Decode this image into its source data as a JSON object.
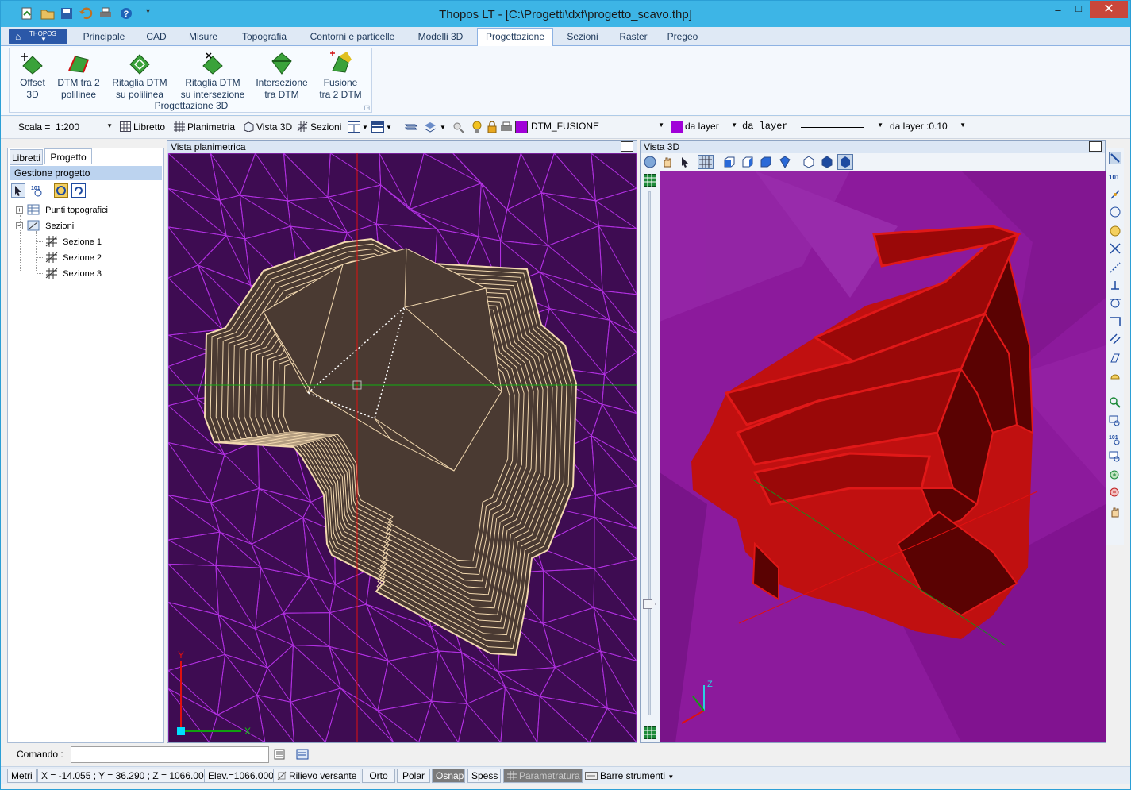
{
  "window": {
    "title": "Thopos LT - [C:\\Progetti\\dxf\\progetto_scavo.thp]",
    "close_glyph": "✕",
    "maximize_glyph": "□",
    "minimize_glyph": "‒"
  },
  "app_button": {
    "label": "THOPOS"
  },
  "tabs": [
    "Principale",
    "CAD",
    "Misure",
    "Topografia",
    "Contorni e particelle",
    "Modelli 3D",
    "Progettazione",
    "Sezioni",
    "Raster",
    "Pregeo"
  ],
  "ribbon": {
    "group_label": "Progettazione 3D",
    "buttons": [
      {
        "label1": "Offset",
        "label2": "3D"
      },
      {
        "label1": "DTM tra 2",
        "label2": "polilinee"
      },
      {
        "label1": "Ritaglia DTM",
        "label2": "su polilinea"
      },
      {
        "label1": "Ritaglia DTM",
        "label2": "su intersezione"
      },
      {
        "label1": "Intersezione",
        "label2": "tra DTM"
      },
      {
        "label1": "Fusione",
        "label2": "tra 2 DTM"
      }
    ]
  },
  "toolbar": {
    "scale_label": "Scala =",
    "scale_value": "1:200",
    "libretto": "Libretto",
    "planimetria": "Planimetria",
    "vista3d": "Vista 3D",
    "sezioni": "Sezioni",
    "layer_name": "DTM_FUSIONE",
    "layer_color": "#a000d8",
    "color_from": "da layer",
    "linetype_from": "da layer",
    "lineweight_from": "da layer :0.10"
  },
  "left_panel": {
    "tab_libretti": "Libretti",
    "tab_progetto": "Progetto",
    "header": "Gestione progetto",
    "tree": {
      "punti": "Punti topografici",
      "sezioni": "Sezioni",
      "children": [
        "Sezione 1",
        "Sezione 2",
        "Sezione 3"
      ]
    }
  },
  "viewport_plan": {
    "title": "Vista planimetrica",
    "axis_x": "X",
    "axis_y": "Y",
    "bg": "#3e0c52",
    "mesh_color": "#b030e0",
    "fill_color": "#4a3a32",
    "line_color": "#f3d9b0"
  },
  "viewport_3d": {
    "title": "Vista 3D",
    "axis_z": "Z",
    "bg": "#8c1a9c",
    "body_color": "#c01010"
  },
  "command": {
    "label": "Comando :",
    "value": ""
  },
  "status": {
    "metri": "Metri",
    "coords": "X = -14.055 ; Y = 36.290 ; Z = 1066.000",
    "elev": "Elev.=1066.000",
    "rilievo": "Rilievo versante",
    "orto": "Orto",
    "polar": "Polar",
    "osnap": "Osnap",
    "spess": "Spess",
    "param": "Parametratura",
    "barre": "Barre strumenti"
  }
}
